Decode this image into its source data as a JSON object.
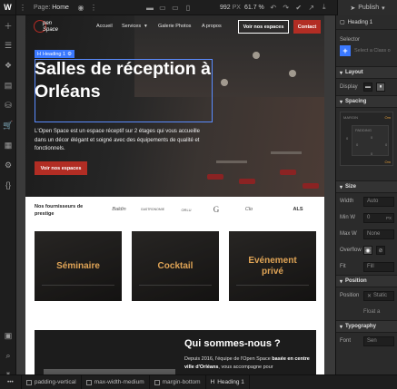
{
  "topbar": {
    "page_label": "Page:",
    "page_name": "Home",
    "width_value": "992",
    "width_unit": "PX",
    "zoom": "61.7 %",
    "publish_label": "Publish"
  },
  "site": {
    "nav": {
      "logo_text_1": "pen",
      "logo_text_2": "Space",
      "links": [
        "Accueil",
        "Services",
        "Galerie Photos",
        "A propos"
      ],
      "cta_outline": "Voir nos espaces",
      "cta_contact": "Contact"
    },
    "selection": {
      "tag": "Heading 1"
    },
    "hero": {
      "title": "Salles de réception à Orléans",
      "paragraph": "L'Open Space est un espace réceptif sur 2 étages qui vous accueille dans un décor élégant et soigné avec des équipements de qualité et fonctionnels.",
      "button": "Voir nos espaces"
    },
    "suppliers": {
      "label": "Nos fournisseurs de prestige",
      "logos": [
        "Baldin",
        "GASTRONOMIE",
        "ORLU",
        "G",
        "Clo",
        "ALS"
      ]
    },
    "cards": [
      "Séminaire",
      "Cocktail",
      "Evénement privé"
    ],
    "about": {
      "title": "Qui sommes-nous ?",
      "p1": "Depuis 2016, l'équipe de l'Open Space ",
      "p1_bold": "basée en centre ville d'Orléans",
      "p2": ", vous accompagne pour"
    }
  },
  "breadcrumb": [
    "padding-vertical",
    "max-width-medium",
    "margin-bottom",
    "Heading 1"
  ],
  "rpanel": {
    "header": "Heading 1",
    "selector_label": "Selector",
    "selector_placeholder": "Select a Class o",
    "layout": "Layout",
    "display_label": "Display",
    "spacing": "Spacing",
    "margin_label": "MARGIN",
    "padding_label": "PADDING",
    "margin_top": "0",
    "padding_top": "0",
    "padding_left": "0",
    "padding_right": "0",
    "padding_bottom": "0",
    "margin_right": "Om",
    "margin_bottom": "Om",
    "size": "Size",
    "width_label": "Width",
    "width_value": "Auto",
    "min_w_label": "Min W",
    "min_w_value": "0",
    "min_w_unit": "PX",
    "max_w_label": "Max W",
    "max_w_value": "None",
    "overflow_label": "Overflow",
    "fit_label": "Fit",
    "fit_value": "Fill",
    "position": "Position",
    "position_label": "Position",
    "position_value": "Static",
    "float_value": "Float a",
    "typography": "Typography",
    "font_label": "Font",
    "font_value": "Sen"
  },
  "colors": {
    "accent_red": "#b22d24",
    "selection_blue": "#3b79ff",
    "gold": "#e0a456"
  }
}
